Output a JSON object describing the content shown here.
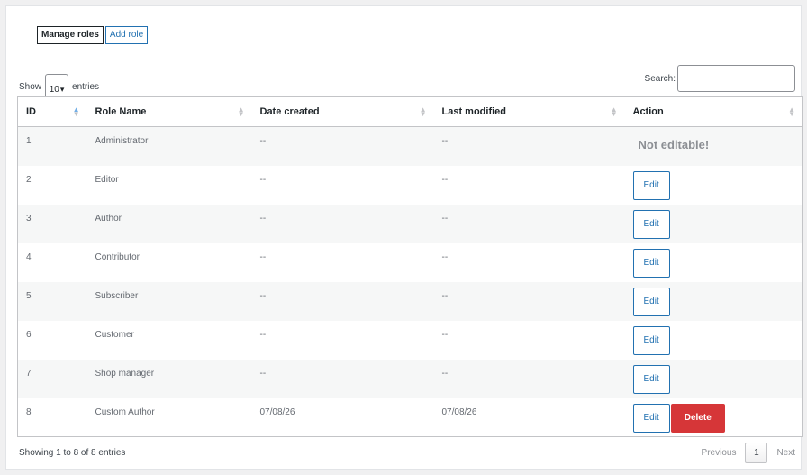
{
  "tabs": {
    "manage_roles": "Manage roles",
    "add_role": "Add role"
  },
  "length_menu": {
    "show_label": "Show",
    "selected_value": "10",
    "entries_label": "entries"
  },
  "search": {
    "label": "Search:",
    "value": "",
    "placeholder": ""
  },
  "table": {
    "columns": [
      "ID",
      "Role Name",
      "Date created",
      "Last modified",
      "Action"
    ],
    "sorted_column": "ID",
    "rows": [
      {
        "id": "1",
        "name": "Administrator",
        "created": "--",
        "modified": "--",
        "action": "Not editable!"
      },
      {
        "id": "2",
        "name": "Editor",
        "created": "--",
        "modified": "--",
        "action": "Edit"
      },
      {
        "id": "3",
        "name": "Author",
        "created": "--",
        "modified": "--",
        "action": "Edit"
      },
      {
        "id": "4",
        "name": "Contributor",
        "created": "--",
        "modified": "--",
        "action": "Edit"
      },
      {
        "id": "5",
        "name": "Subscriber",
        "created": "--",
        "modified": "--",
        "action": "Edit"
      },
      {
        "id": "6",
        "name": "Customer",
        "created": "--",
        "modified": "--",
        "action": "Edit"
      },
      {
        "id": "7",
        "name": "Shop manager",
        "created": "--",
        "modified": "--",
        "action": "Edit"
      },
      {
        "id": "8",
        "name": "Custom Author",
        "created": "07/08/26",
        "modified": "07/08/26",
        "action": "Edit",
        "delete": "Delete"
      }
    ]
  },
  "footer": {
    "info": "Showing 1 to 8 of 8 entries",
    "previous": "Previous",
    "current_page": "1",
    "next": "Next"
  },
  "colors": {
    "link_blue": "#2271b1",
    "delete_red": "#d63638",
    "stripe": "#f6f7f7"
  }
}
